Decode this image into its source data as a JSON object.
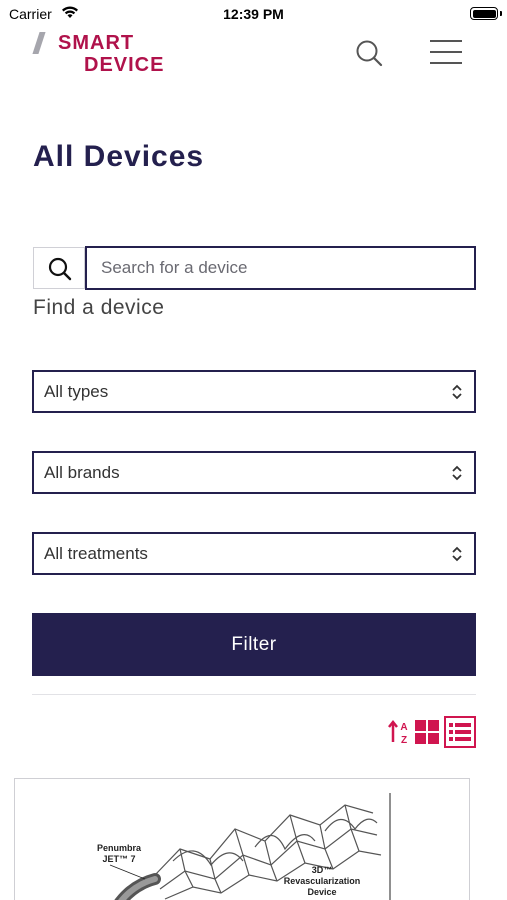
{
  "status_bar": {
    "carrier": "Carrier",
    "time": "12:39 PM"
  },
  "header": {
    "logo_line1": "SMART",
    "logo_line2": "DEVICE",
    "brand_color": "#b0124b",
    "search_icon": "search-icon",
    "menu_icon": "hamburger-menu-icon"
  },
  "page": {
    "title": "All Devices"
  },
  "search": {
    "placeholder": "Search for a device",
    "value": "",
    "label": "Find a device"
  },
  "filters": {
    "type": "All types",
    "brand": "All brands",
    "treatment": "All treatments",
    "button_label": "Filter",
    "primary_color": "#24204e"
  },
  "view_controls": {
    "sort_icon": "sort-alpha-icon",
    "grid_icon": "grid-view-icon",
    "list_icon": "list-view-icon",
    "active": "list",
    "accent_color": "#d0154f"
  },
  "device_card": {
    "label_left_line1": "Penumbra",
    "label_left_line2": "JET™ 7",
    "label_right_line1": "3D™",
    "label_right_line2": "Revascularization",
    "label_right_line3": "Device"
  }
}
